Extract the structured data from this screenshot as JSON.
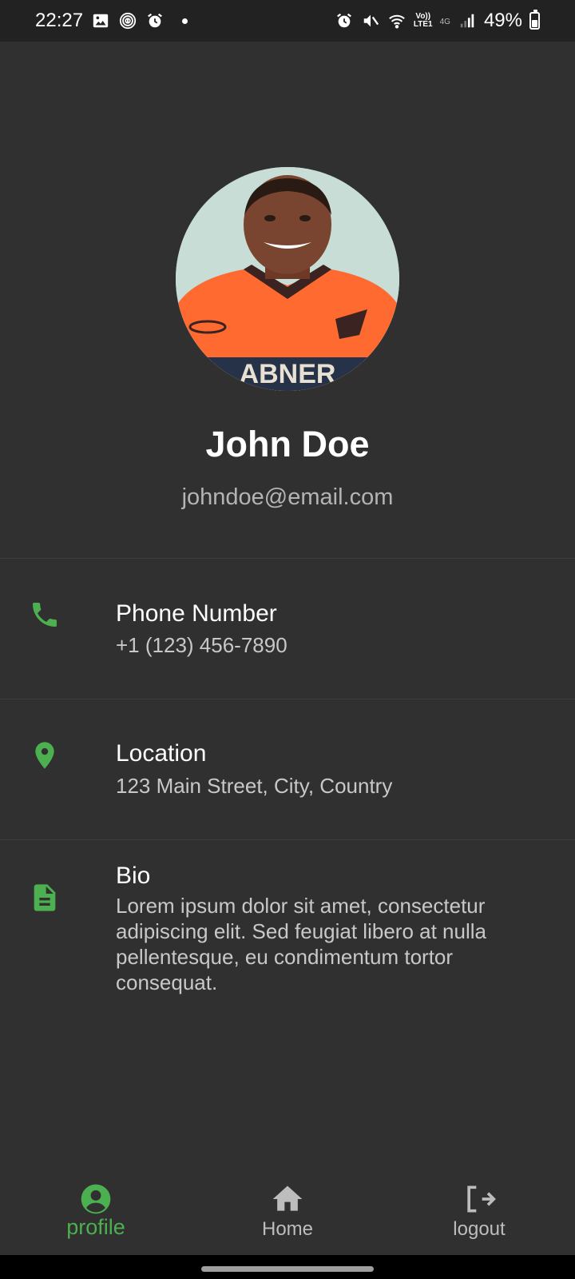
{
  "status_bar": {
    "time": "22:27",
    "network_top": "Vo))",
    "network_bottom": "LTE1",
    "network_type": "4G",
    "battery_percent": "49%",
    "battery_level": 0.49
  },
  "profile": {
    "name": "John Doe",
    "email": "johndoe@email.com",
    "avatar_jersey_text": "ABNER"
  },
  "info": {
    "phone": {
      "icon": "phone-icon",
      "title": "Phone Number",
      "value": "+1 (123) 456-7890"
    },
    "location": {
      "icon": "location-pin-icon",
      "title": "Location",
      "value": "123 Main Street, City, Country"
    },
    "bio": {
      "icon": "document-icon",
      "title": "Bio",
      "lines": [
        "Lorem ipsum dolor sit amet, consectetur",
        "adipiscing elit. Sed feugiat libero at nulla",
        "pellentesque, eu condimentum tortor",
        "consequat."
      ]
    }
  },
  "bottom_nav": {
    "items": [
      {
        "icon": "account-circle-icon",
        "label": "profile",
        "active": true
      },
      {
        "icon": "home-icon",
        "label": "Home",
        "active": false
      },
      {
        "icon": "logout-icon",
        "label": "logout",
        "active": false
      }
    ]
  },
  "colors": {
    "background": "#303030",
    "status_bar": "#222222",
    "accent": "#4caf50",
    "text_primary": "#ffffff",
    "text_secondary": "#b4b4b4",
    "nav_inactive": "#bdbdbd"
  }
}
